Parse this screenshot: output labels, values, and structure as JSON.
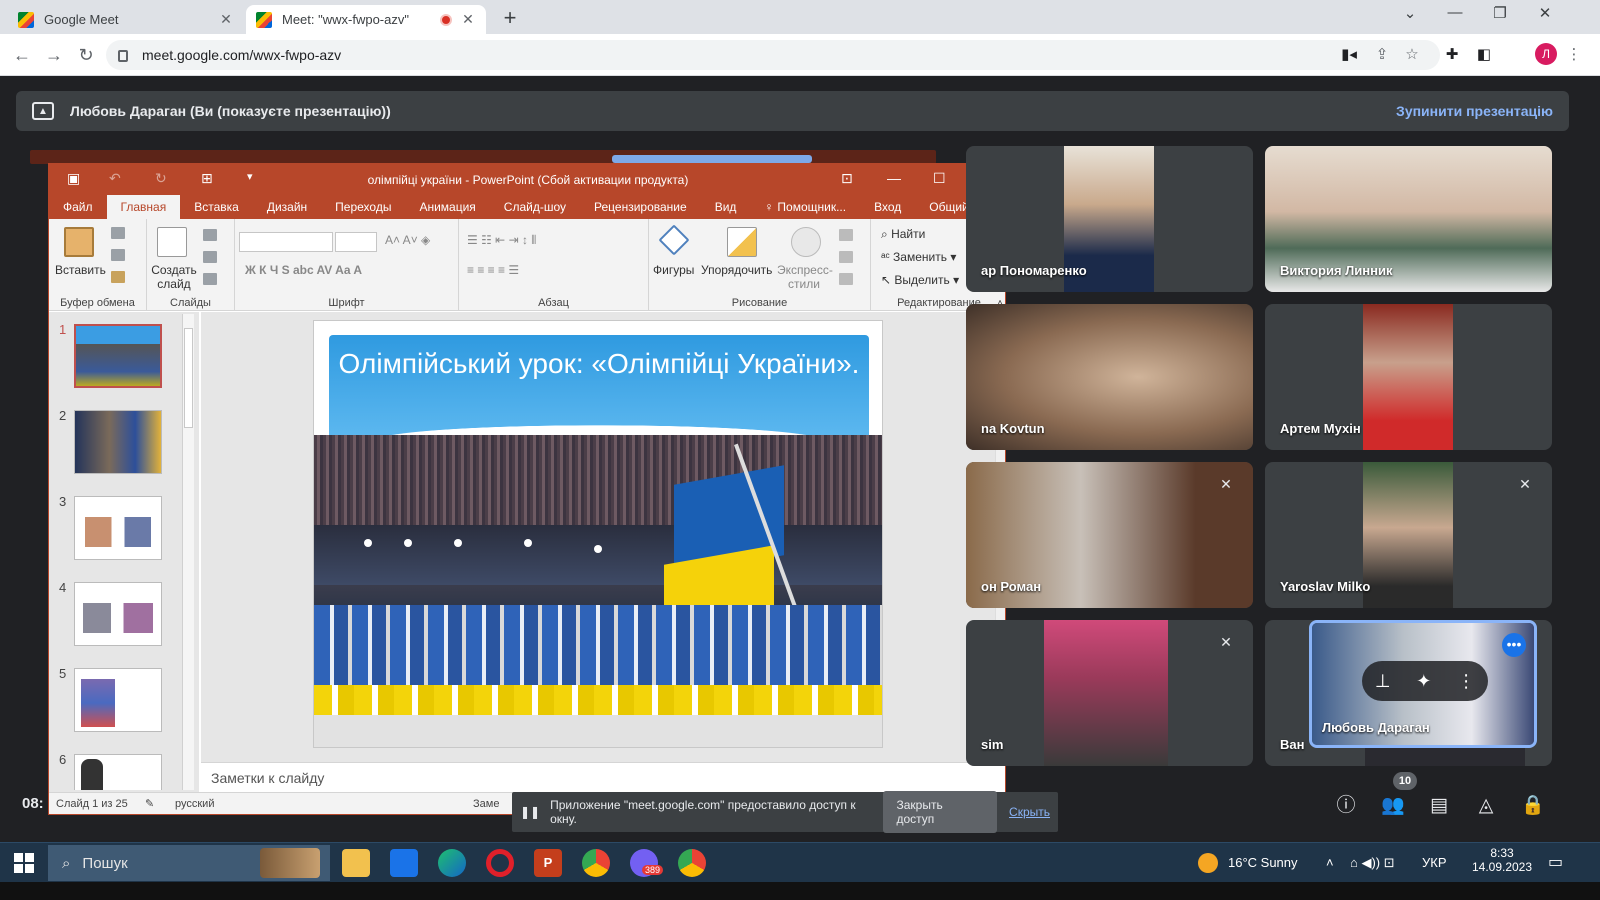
{
  "browser": {
    "tabs": [
      {
        "title": "Google Meet",
        "active": false
      },
      {
        "title": "Meet: \"wwx-fwpo-azv\"",
        "active": true
      }
    ],
    "url": "meet.google.com/wwx-fwpo-azv",
    "profile_initial": "Л"
  },
  "meet": {
    "presenting_text": "Любовь Дараган (Ви (показуєте презентацію))",
    "stop_presenting": "Зупинити презентацію",
    "time": "08:",
    "participants_count": "10",
    "share_notice": "Приложение \"meet.google.com\" предоставило доступ к окну.",
    "close_access": "Закрыть доступ",
    "hide": "Скрыть",
    "participants": [
      {
        "name": "ар Пономаренко",
        "muted": false
      },
      {
        "name": "Виктория Линник",
        "muted": false
      },
      {
        "name": "na Kovtun",
        "muted": false
      },
      {
        "name": "Артем Мухін",
        "muted": false
      },
      {
        "name": "он Роман",
        "muted": true
      },
      {
        "name": "Yaroslav Milko",
        "muted": true
      },
      {
        "name": "sim",
        "muted": true
      },
      {
        "name": "Ван",
        "muted": false
      },
      {
        "name": "Любовь Дараган",
        "muted": false
      }
    ]
  },
  "ppt": {
    "window_title": "олімпійці україни - PowerPoint (Сбой активации продукта)",
    "tabs": [
      "Файл",
      "Главная",
      "Вставка",
      "Дизайн",
      "Переходы",
      "Анимация",
      "Слайд-шоу",
      "Рецензирование",
      "Вид",
      "Помощник...",
      "Вход",
      "Общий доступ"
    ],
    "ribbon": {
      "paste": "Вставить",
      "create_slide": "Создать слайд",
      "shapes": "Фигуры",
      "arrange": "Упорядочить",
      "express": "Экспресс-стили",
      "find": "Найти",
      "replace": "Заменить",
      "select": "Выделить",
      "groups": [
        "Буфер обмена",
        "Слайды",
        "Шрифт",
        "Абзац",
        "Рисование",
        "Редактирование"
      ]
    },
    "slide_title": "Олімпійський урок: «Олімпійці України».",
    "thumb_numbers": [
      "1",
      "2",
      "3",
      "4",
      "5",
      "6"
    ],
    "notes_placeholder": "Заметки к слайду",
    "status": {
      "slide_counter": "Слайд 1 из 25",
      "language": "русский",
      "notes": "Заме"
    }
  },
  "taskbar": {
    "search": "Пошук",
    "weather": "16°C  Sunny",
    "language": "УКР",
    "time": "8:33",
    "date": "14.09.2023",
    "viber_badge": "389"
  }
}
